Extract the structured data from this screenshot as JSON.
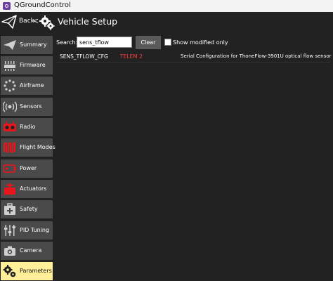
{
  "window": {
    "title": "QGroundControl"
  },
  "header": {
    "back_label": "Back",
    "back_chevron": "<",
    "title": "Vehicle Setup"
  },
  "sidebar": {
    "items": [
      {
        "label": "Summary",
        "icon": "paper-plane-icon"
      },
      {
        "label": "Firmware",
        "icon": "firmware-icon"
      },
      {
        "label": "Airframe",
        "icon": "airframe-icon"
      },
      {
        "label": "Sensors",
        "icon": "sensors-icon"
      },
      {
        "label": "Radio",
        "icon": "radio-icon"
      },
      {
        "label": "Flight Modes",
        "icon": "flight-modes-icon"
      },
      {
        "label": "Power",
        "icon": "battery-icon"
      },
      {
        "label": "Actuators",
        "icon": "actuators-icon"
      },
      {
        "label": "Safety",
        "icon": "safety-icon"
      },
      {
        "label": "PID Tuning",
        "icon": "sliders-icon"
      },
      {
        "label": "Camera",
        "icon": "camera-icon"
      },
      {
        "label": "Parameters",
        "icon": "gears-icon",
        "active": true
      }
    ]
  },
  "search": {
    "label": "Search:",
    "value": "sens_tflow",
    "clear_label": "Clear",
    "show_modified_label": "Show modified only"
  },
  "params": [
    {
      "name": "SENS_TFLOW_CFG",
      "value": "TELEM 2",
      "description": "Serial Configuration for ThoneFlow-3901U optical flow sensor"
    }
  ],
  "colors": {
    "background": "#222222",
    "nav_item": "#4a4a4a",
    "nav_active": "#ffef99",
    "value_text": "#ff3b3b",
    "icon_red": "#e8151c"
  }
}
